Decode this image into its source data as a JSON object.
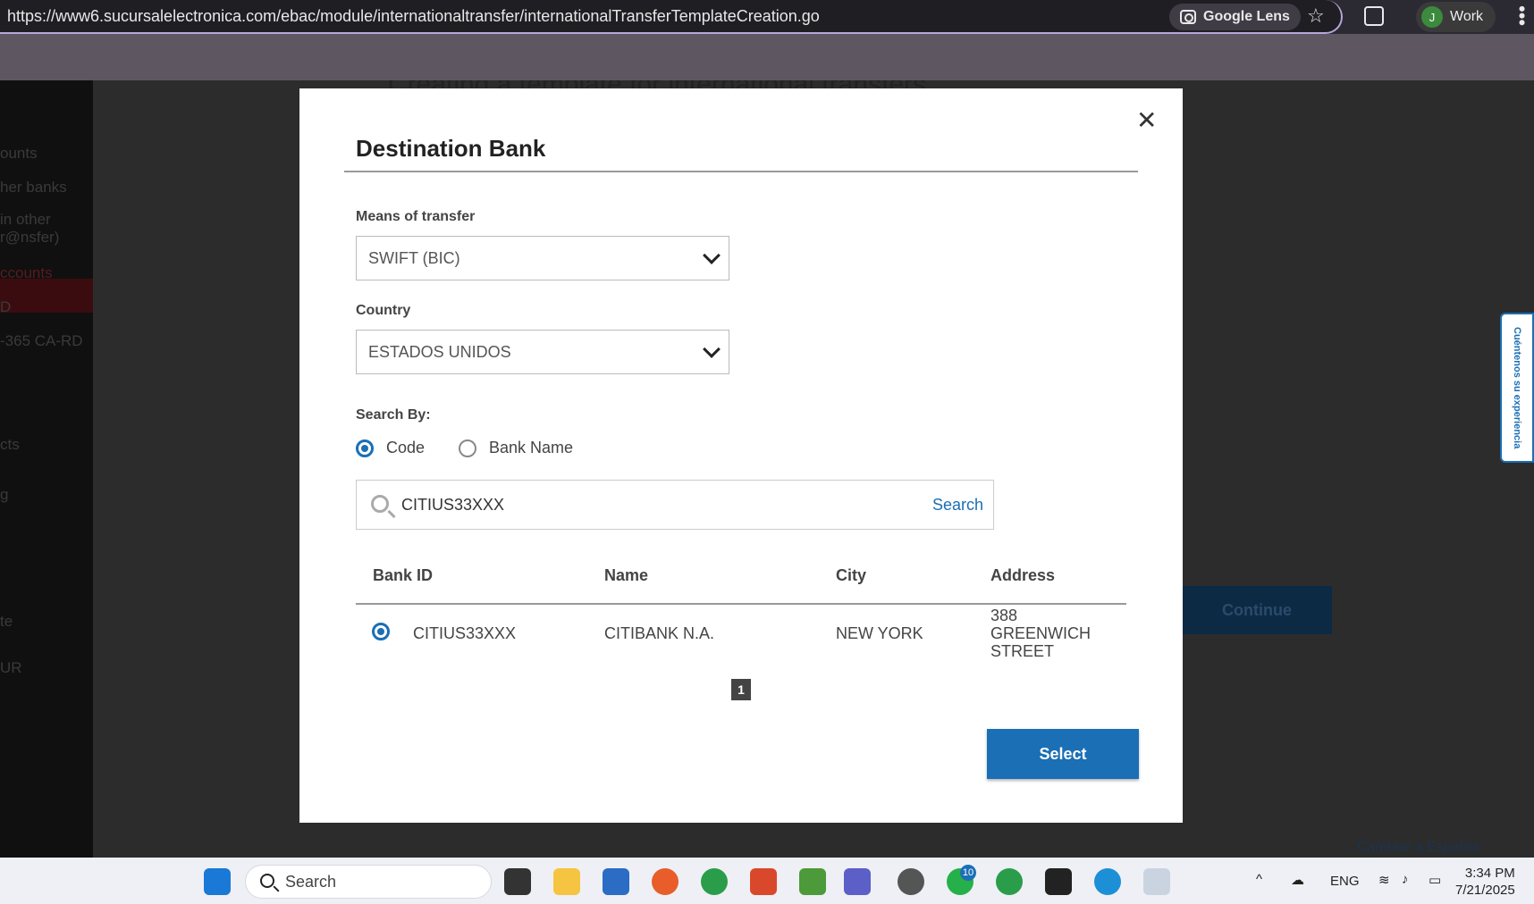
{
  "browser": {
    "url": "https://www6.sucursalelectronica.com/ebac/module/internationaltransfer/internationalTransferTemplateCreation.go",
    "lens_label": "Google Lens",
    "profile_initial": "J",
    "profile_name": "Work"
  },
  "background": {
    "title_partial": "Creating a template for international transfers",
    "nav_items": [
      "ounts",
      "her banks",
      "in other",
      "r@nsfer)",
      "ccounts",
      "D",
      "-365 CA-RD",
      "cts",
      "g",
      "te",
      "UR"
    ],
    "continue_label": "Continue",
    "lang_link": "Cambiar a Español",
    "feedback_label": "Cuéntenos su experiencia"
  },
  "modal": {
    "title": "Destination Bank",
    "means_label": "Means of transfer",
    "means_value": "SWIFT (BIC)",
    "country_label": "Country",
    "country_value": "ESTADOS UNIDOS",
    "search_by_label": "Search By:",
    "search_by_options": [
      "Code",
      "Bank Name"
    ],
    "search_by_selected": "Code",
    "search_value": "CITIUS33XXX",
    "search_button": "Search",
    "table": {
      "headers": [
        "Bank ID",
        "Name",
        "City",
        "Address"
      ],
      "rows": [
        {
          "bank_id": "CITIUS33XXX",
          "name": "CITIBANK N.A.",
          "city": "NEW YORK",
          "address": [
            "388",
            "GREENWICH",
            "STREET"
          ],
          "selected": true
        }
      ]
    },
    "page": "1",
    "select_button": "Select"
  },
  "taskbar": {
    "search_placeholder": "Search",
    "language": "ENG",
    "time": "3:34 PM",
    "date": "7/21/2025",
    "whatsapp_badge": "10"
  }
}
